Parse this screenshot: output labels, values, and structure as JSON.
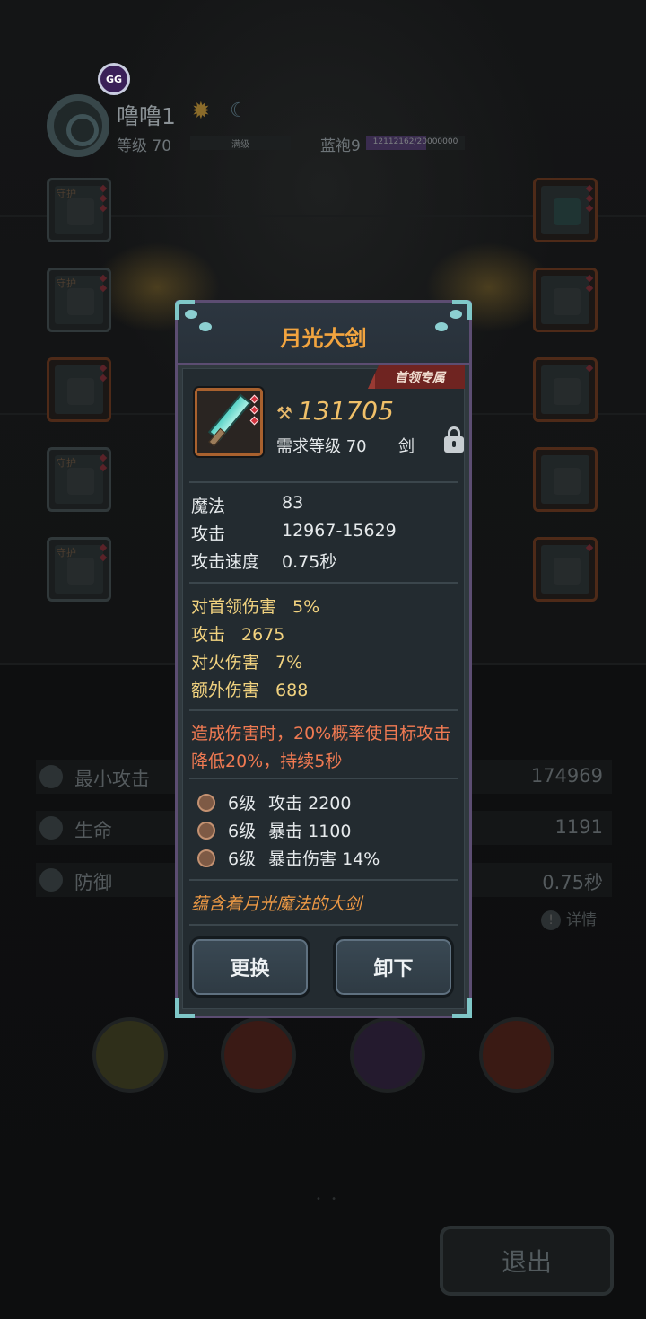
{
  "header": {
    "gg_label": "GG",
    "player_name": "噜噜1",
    "level_label": "等级 70",
    "level_bar_label": "满级",
    "class_label": "蓝袍9",
    "exp_progress": 0.6056,
    "exp_text": "12112162/20000000"
  },
  "equipment_left": [
    {
      "tag": "守护"
    },
    {
      "tag": "守护"
    },
    {
      "tag": ""
    },
    {
      "tag": "守护"
    },
    {
      "tag": "守护"
    }
  ],
  "stats": [
    {
      "label": "最小攻击",
      "value": "174969",
      "icon": "sword-icon"
    },
    {
      "label": "生命",
      "value": "1191",
      "icon": "heart-icon"
    },
    {
      "label": "防御",
      "value": "0.75秒",
      "icon": "shield-icon"
    }
  ],
  "detail_label": "详情",
  "exit_label": "退出",
  "modal": {
    "title": "月光大剑",
    "badge": "首领专属",
    "power_value": "131705",
    "requirement": "需求等级 70",
    "item_type": "剑",
    "base_stats": [
      {
        "label": "魔法",
        "value": "83"
      },
      {
        "label": "攻击",
        "value": "12967-15629"
      },
      {
        "label": "攻击速度",
        "value": "0.75秒"
      }
    ],
    "bonus_stats": [
      {
        "label": "对首领伤害",
        "value": "5%"
      },
      {
        "label": "攻击",
        "value": "2675"
      },
      {
        "label": "对火伤害",
        "value": "7%"
      },
      {
        "label": "额外伤害",
        "value": "688"
      }
    ],
    "effect": "造成伤害时，20%概率使目标攻击降低20%，持续5秒",
    "gems": [
      {
        "level": "6级",
        "stat": "攻击 2200"
      },
      {
        "level": "6级",
        "stat": "暴击 1100"
      },
      {
        "level": "6级",
        "stat": "暴击伤害 14%"
      }
    ],
    "flavor": "蕴含着月光魔法的大剑",
    "replace_label": "更换",
    "unequip_label": "卸下"
  },
  "colors": {
    "title": "#f2a43f",
    "power": "#f0c069",
    "bonus": "#f1d27f",
    "effect": "#f07a52",
    "flavor": "#ef9a45",
    "modal_border": "#5c4d72",
    "accent_teal": "#7fc7c8"
  }
}
